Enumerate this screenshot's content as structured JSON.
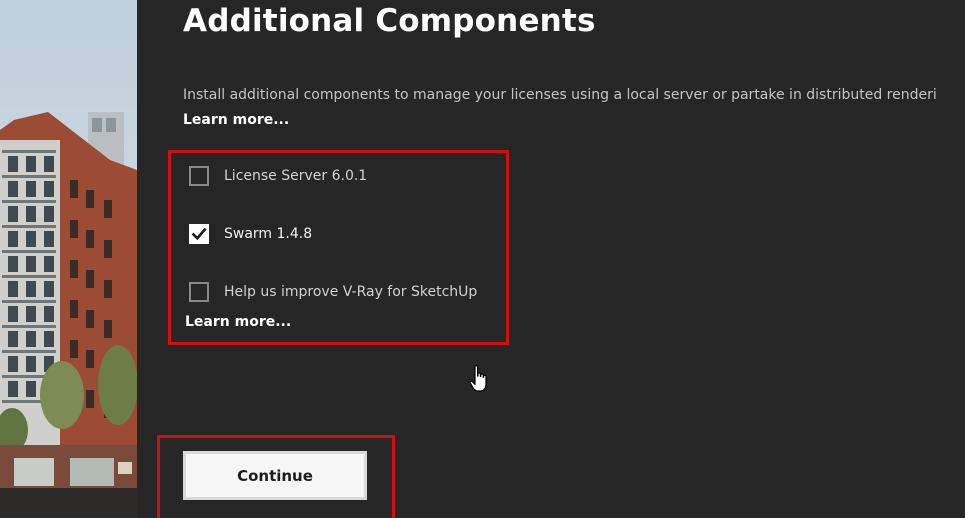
{
  "page": {
    "title": "Additional Components",
    "description": "Install additional components to manage your licenses using a local server or partake in distributed renderi",
    "learn_more_top": "Learn more...",
    "learn_more_bottom": "Learn more..."
  },
  "options": [
    {
      "label": "License Server 6.0.1",
      "checked": false
    },
    {
      "label": "Swarm 1.4.8",
      "checked": true
    },
    {
      "label": "Help us improve V-Ray for SketchUp",
      "checked": false
    }
  ],
  "continue_label": "Continue",
  "colors": {
    "background": "#262626",
    "highlight": "#d10f0f",
    "button_bg": "#f6f6f6",
    "text_primary": "#ffffff",
    "text_secondary": "#c4c4c4"
  },
  "icons": {
    "check": "check-icon",
    "cursor": "hand-pointer-icon"
  }
}
